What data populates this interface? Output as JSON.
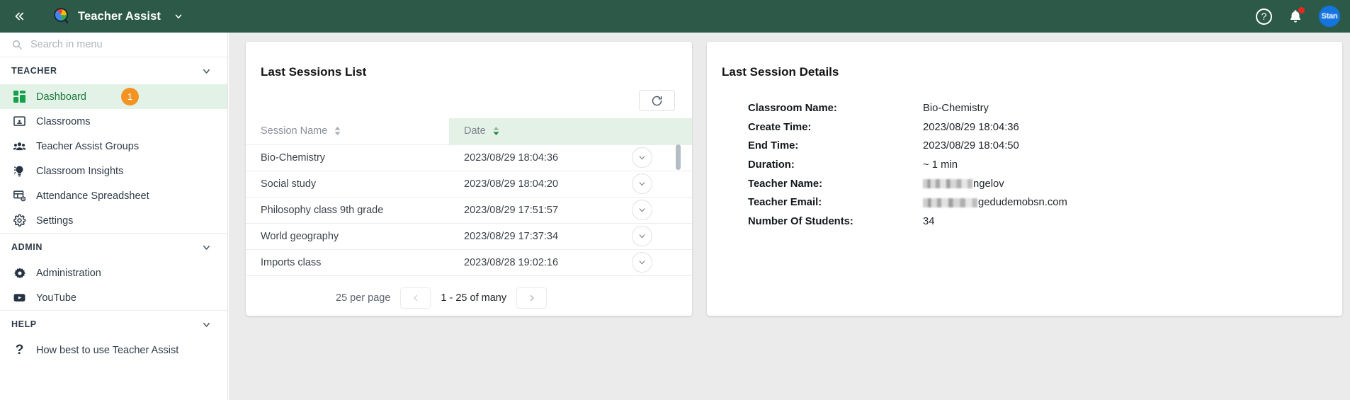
{
  "topbar": {
    "collapse_icon": "double-chevron-left",
    "logo_icon": "magnifier-logo",
    "brand": "Teacher Assist",
    "brand_caret_icon": "chevron-down",
    "help_icon": "question-mark",
    "notifications_icon": "bell",
    "avatar_label": "Stan",
    "avatar_color": "#1575e0",
    "bar_color": "#2d5a48"
  },
  "sidebar": {
    "search": {
      "placeholder": "Search in menu",
      "value": "",
      "icon": "search-icon"
    },
    "sections": [
      {
        "title": "TEACHER",
        "items": [
          {
            "label": "Dashboard",
            "icon": "dashboard-grid-icon",
            "active": true,
            "badge": "1"
          },
          {
            "label": "Classrooms",
            "icon": "classroom-board-icon",
            "active": false,
            "badge": ""
          },
          {
            "label": "Teacher Assist Groups",
            "icon": "people-group-icon",
            "active": false,
            "badge": ""
          },
          {
            "label": "Classroom Insights",
            "icon": "lightbulb-icon",
            "active": false,
            "badge": ""
          },
          {
            "label": "Attendance Spreadsheet",
            "icon": "spreadsheet-eye-icon",
            "active": false,
            "badge": ""
          },
          {
            "label": "Settings",
            "icon": "gear-icon",
            "active": false,
            "badge": ""
          }
        ]
      },
      {
        "title": "ADMIN",
        "items": [
          {
            "label": "Administration",
            "icon": "gear-solid-icon",
            "active": false,
            "badge": ""
          },
          {
            "label": "YouTube",
            "icon": "youtube-icon",
            "active": false,
            "badge": ""
          }
        ]
      },
      {
        "title": "HELP",
        "items": [
          {
            "label": "How best to use Teacher Assist",
            "icon": "question-mark-icon",
            "active": false,
            "badge": ""
          }
        ]
      }
    ]
  },
  "sessions_card": {
    "title": "Last Sessions List",
    "refresh_icon": "refresh-icon",
    "columns": [
      {
        "label": "Session Name",
        "sort": "none",
        "sort_icon": "sort-both-icon"
      },
      {
        "label": "Date",
        "sort": "desc",
        "sort_icon": "sort-desc-icon"
      },
      {
        "label": "",
        "sort": "none",
        "sort_icon": ""
      }
    ],
    "rows": [
      {
        "session_name": "Bio-Chemistry",
        "date": "2023/08/29 18:04:36",
        "expand_icon": "chevron-down-icon"
      },
      {
        "session_name": "Social study",
        "date": "2023/08/29 18:04:20",
        "expand_icon": "chevron-down-icon"
      },
      {
        "session_name": "Philosophy class 9th grade",
        "date": "2023/08/29 17:51:57",
        "expand_icon": "chevron-down-icon"
      },
      {
        "session_name": "World geography",
        "date": "2023/08/29 17:37:34",
        "expand_icon": "chevron-down-icon"
      },
      {
        "session_name": "Imports class",
        "date": "2023/08/28 19:02:16",
        "expand_icon": "chevron-down-icon"
      }
    ],
    "pager": {
      "per_page": "25 per page",
      "prev_icon": "chevron-left-icon",
      "range": "1 - 25  of many",
      "next_icon": "chevron-right-icon"
    }
  },
  "details_card": {
    "title": "Last Session Details",
    "fields": [
      {
        "key": "Classroom Name:",
        "value": "Bio-Chemistry",
        "redacted": false,
        "redact_width": 0
      },
      {
        "key": "Create Time:",
        "value": "2023/08/29 18:04:36",
        "redacted": false,
        "redact_width": 0
      },
      {
        "key": "End Time:",
        "value": "2023/08/29 18:04:50",
        "redacted": false,
        "redact_width": 0
      },
      {
        "key": "Duration:",
        "value": "~ 1 min",
        "redacted": false,
        "redact_width": 0
      },
      {
        "key": "Teacher Name:",
        "value": "ngelov",
        "redacted": true,
        "redact_width": 70
      },
      {
        "key": "Teacher Email:",
        "value": "gedudemobsn.com",
        "redacted": true,
        "redact_width": 77
      },
      {
        "key": "Number Of Students:",
        "value": "34",
        "redacted": false,
        "redact_width": 0
      }
    ]
  }
}
